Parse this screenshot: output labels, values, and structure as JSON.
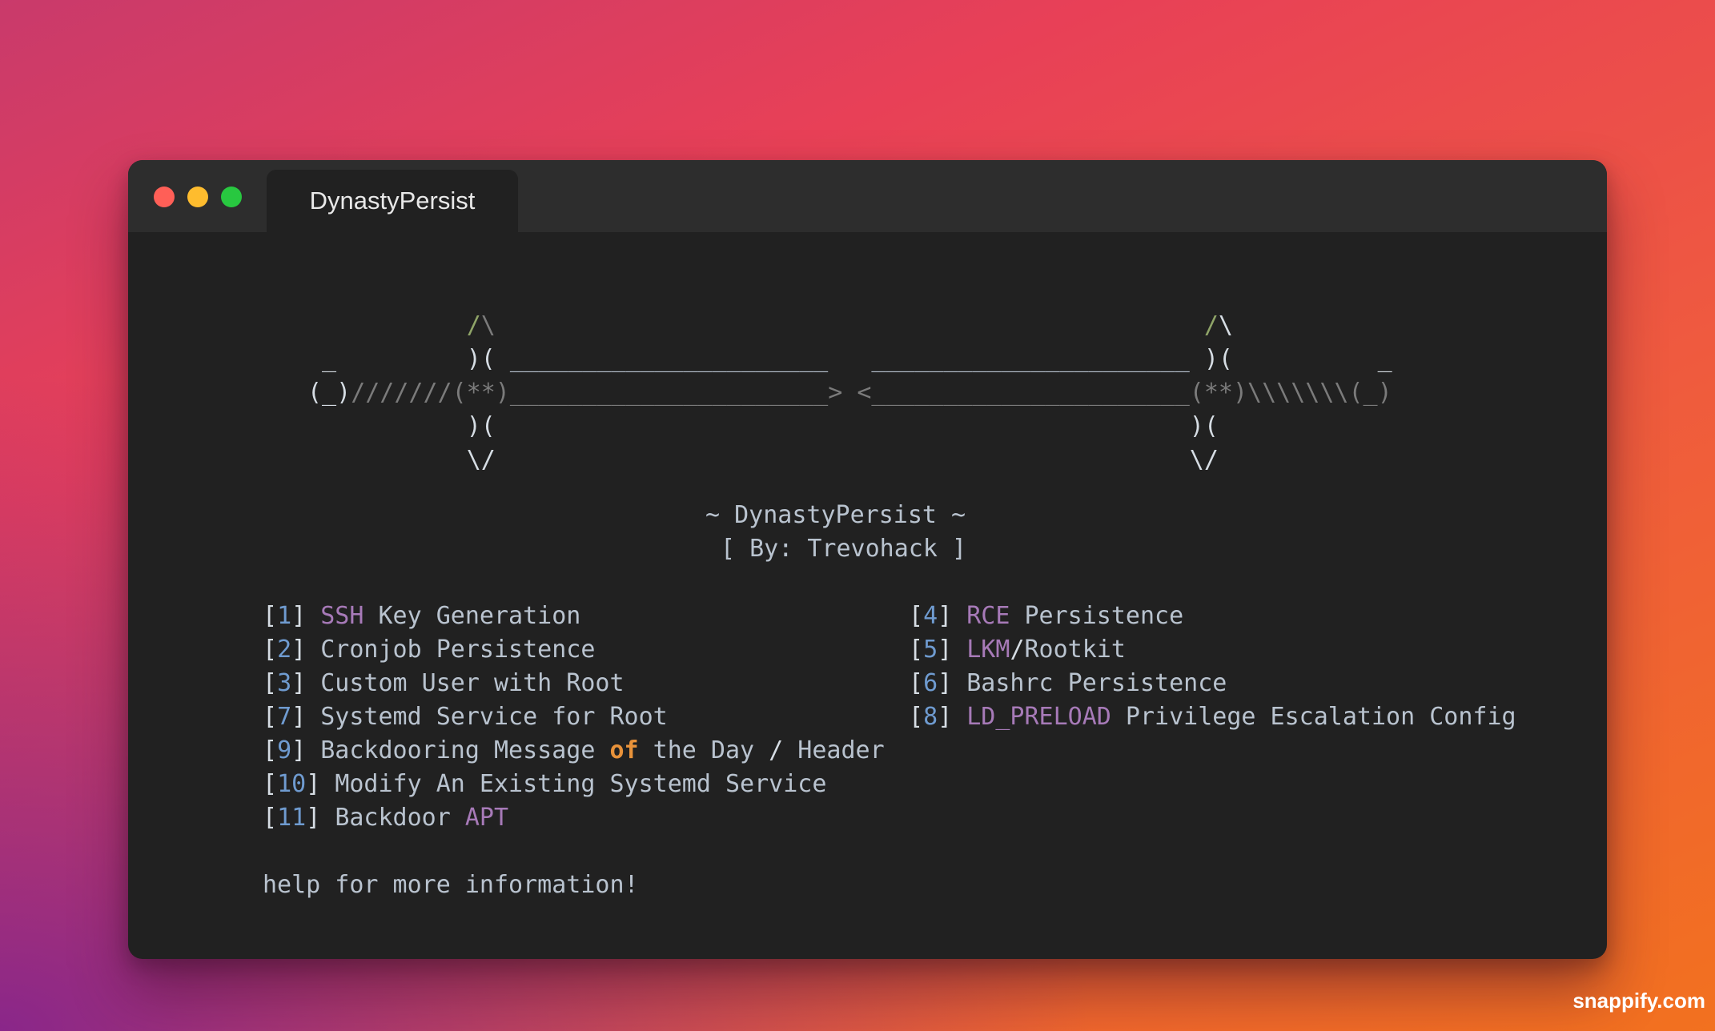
{
  "window": {
    "tab_title": "DynastyPersist"
  },
  "banner": {
    "art": [
      {
        "segments": [
          {
            "text": "           ",
            "c": "l"
          },
          {
            "text": "/",
            "c": "g"
          },
          {
            "text": "\\",
            "c": "d"
          },
          {
            "text": "                                                 ",
            "c": "l"
          },
          {
            "text": "/",
            "c": "g"
          },
          {
            "text": "\\",
            "c": "w"
          }
        ]
      },
      {
        "segments": [
          {
            "text": " _         ",
            "c": "w"
          },
          {
            "text": ")( ",
            "c": "w"
          },
          {
            "text": "______________________",
            "c": "l"
          },
          {
            "text": "   ",
            "c": "l"
          },
          {
            "text": "______________________",
            "c": "l"
          },
          {
            "text": " )(          _",
            "c": "w"
          }
        ]
      },
      {
        "segments": [
          {
            "text": "(_)",
            "c": "w"
          },
          {
            "text": "///////",
            "c": "d"
          },
          {
            "text": "(**)",
            "c": "d"
          },
          {
            "text": "______________________> <______________________",
            "c": "d"
          },
          {
            "text": "(**)",
            "c": "d"
          },
          {
            "text": "\\\\\\\\\\\\\\",
            "c": "d"
          },
          {
            "text": "(_)",
            "c": "d"
          }
        ]
      },
      {
        "segments": [
          {
            "text": "           ",
            "c": "l"
          },
          {
            "text": ")(",
            "c": "w"
          },
          {
            "text": "                                                ",
            "c": "l"
          },
          {
            "text": ")(",
            "c": "w"
          }
        ]
      },
      {
        "segments": [
          {
            "text": "           ",
            "c": "l"
          },
          {
            "text": "\\/",
            "c": "w"
          },
          {
            "text": "                                                ",
            "c": "l"
          },
          {
            "text": "\\/",
            "c": "w"
          }
        ]
      }
    ],
    "title": "~ DynastyPersist ~",
    "author": "[ By: Trevohack ]"
  },
  "menu": {
    "left": [
      {
        "num": "1",
        "segments": [
          {
            "text": "SSH",
            "c": "kw"
          },
          {
            "text": " Key Generation",
            "c": "txt"
          }
        ]
      },
      {
        "num": "2",
        "segments": [
          {
            "text": "Cronjob Persistence",
            "c": "txt"
          }
        ]
      },
      {
        "num": "3",
        "segments": [
          {
            "text": "Custom User with Root",
            "c": "txt"
          }
        ]
      },
      {
        "num": "7",
        "segments": [
          {
            "text": "Systemd Service for Root",
            "c": "txt"
          }
        ]
      },
      {
        "num": "9",
        "segments": [
          {
            "text": "Backdooring Message ",
            "c": "txt"
          },
          {
            "text": "of",
            "c": "orange"
          },
          {
            "text": " the Day ",
            "c": "txt"
          },
          {
            "text": "/",
            "c": "br"
          },
          {
            "text": " Header",
            "c": "txt"
          }
        ]
      },
      {
        "num": "10",
        "segments": [
          {
            "text": "Modify An Existing Systemd Service",
            "c": "txt"
          }
        ]
      },
      {
        "num": "11",
        "segments": [
          {
            "text": "Backdoor ",
            "c": "txt"
          },
          {
            "text": "APT",
            "c": "kw"
          }
        ]
      }
    ],
    "right": [
      {
        "num": "4",
        "segments": [
          {
            "text": "RCE",
            "c": "kw"
          },
          {
            "text": " Persistence",
            "c": "txt"
          }
        ]
      },
      {
        "num": "5",
        "segments": [
          {
            "text": "LKM",
            "c": "kw"
          },
          {
            "text": "/",
            "c": "br"
          },
          {
            "text": "Rootkit",
            "c": "txt"
          }
        ]
      },
      {
        "num": "6",
        "segments": [
          {
            "text": "Bashrc Persistence",
            "c": "txt"
          }
        ]
      },
      {
        "num": "8",
        "segments": [
          {
            "text": "LD_PRELOAD",
            "c": "kw"
          },
          {
            "text": " Privilege Escalation Config",
            "c": "txt"
          }
        ]
      }
    ]
  },
  "help_text": "help for more information!",
  "watermark": "snappify.com",
  "colors": {
    "terminal_bg": "#212121",
    "titlebar_bg": "#2d2d2d",
    "number": "#6f9bd0",
    "keyword": "#a77ab8",
    "highlight": "#e8923a",
    "text": "#b9c3cf"
  }
}
